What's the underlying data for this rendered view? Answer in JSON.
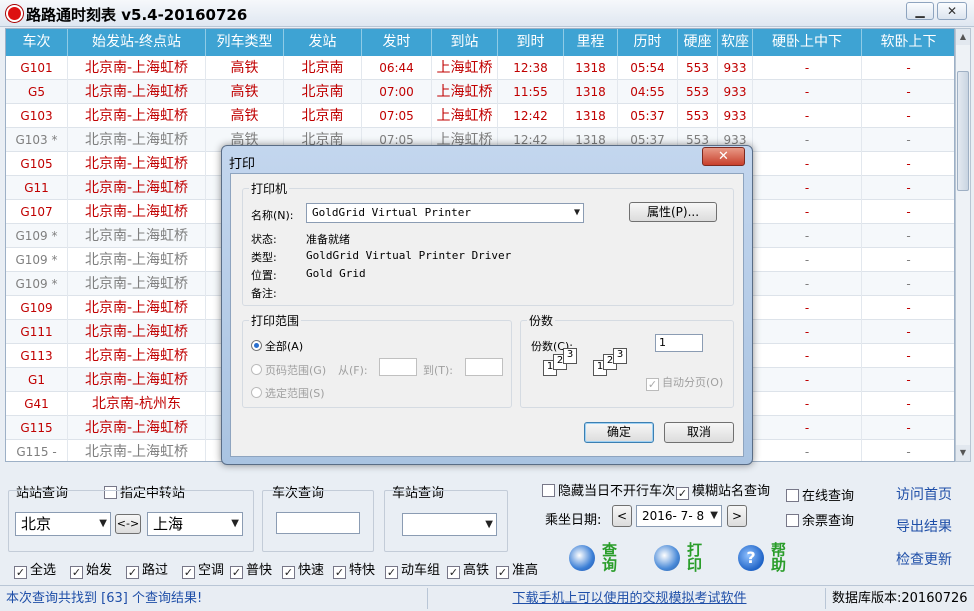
{
  "window": {
    "title": "路路通时刻表 v5.4-20160726",
    "min": "▁",
    "close": "✕"
  },
  "table": {
    "headers": [
      "车次",
      "始发站-终点站",
      "列车类型",
      "发站",
      "发时",
      "到站",
      "到时",
      "里程",
      "历时",
      "硬座",
      "软座",
      "硬卧上中下",
      "软卧上下"
    ],
    "rows": [
      {
        "style": "red",
        "cells": [
          "G101",
          "北京南-上海虹桥",
          "高铁",
          "北京南",
          "06:44",
          "上海虹桥",
          "12:38",
          "1318",
          "05:54",
          "553",
          "933",
          "-",
          "-"
        ]
      },
      {
        "style": "red",
        "cells": [
          "G5",
          "北京南-上海虹桥",
          "高铁",
          "北京南",
          "07:00",
          "上海虹桥",
          "11:55",
          "1318",
          "04:55",
          "553",
          "933",
          "-",
          "-"
        ]
      },
      {
        "style": "red",
        "cells": [
          "G103",
          "北京南-上海虹桥",
          "高铁",
          "北京南",
          "07:05",
          "上海虹桥",
          "12:42",
          "1318",
          "05:37",
          "553",
          "933",
          "-",
          "-"
        ]
      },
      {
        "style": "gray",
        "cells": [
          "G103 *",
          "北京南-上海虹桥",
          "高铁",
          "北京南",
          "07:05",
          "上海虹桥",
          "12:42",
          "1318",
          "05:37",
          "553",
          "933",
          "-",
          "-"
        ]
      },
      {
        "style": "red",
        "cells": [
          "G105",
          "北京南-上海虹桥",
          "",
          "",
          "",
          "",
          "",
          "",
          "",
          "",
          "",
          "-",
          "-"
        ]
      },
      {
        "style": "red",
        "cells": [
          "G11",
          "北京南-上海虹桥",
          "",
          "",
          "",
          "",
          "",
          "",
          "",
          "",
          "",
          "-",
          "-"
        ]
      },
      {
        "style": "red",
        "cells": [
          "G107",
          "北京南-上海虹桥",
          "",
          "",
          "",
          "",
          "",
          "",
          "",
          "",
          "",
          "-",
          "-"
        ]
      },
      {
        "style": "gray",
        "cells": [
          "G109 *",
          "北京南-上海虹桥",
          "",
          "",
          "",
          "",
          "",
          "",
          "",
          "",
          "",
          "-",
          "-"
        ]
      },
      {
        "style": "gray",
        "cells": [
          "G109 *",
          "北京南-上海虹桥",
          "",
          "",
          "",
          "",
          "",
          "",
          "",
          "",
          "",
          "-",
          "-"
        ]
      },
      {
        "style": "gray",
        "cells": [
          "G109 *",
          "北京南-上海虹桥",
          "",
          "",
          "",
          "",
          "",
          "",
          "",
          "",
          "",
          "-",
          "-"
        ]
      },
      {
        "style": "red",
        "cells": [
          "G109",
          "北京南-上海虹桥",
          "",
          "",
          "",
          "",
          "",
          "",
          "",
          "",
          "",
          "-",
          "-"
        ]
      },
      {
        "style": "red",
        "cells": [
          "G111",
          "北京南-上海虹桥",
          "",
          "",
          "",
          "",
          "",
          "",
          "",
          "",
          "",
          "-",
          "-"
        ]
      },
      {
        "style": "red",
        "cells": [
          "G113",
          "北京南-上海虹桥",
          "",
          "",
          "",
          "",
          "",
          "",
          "",
          "",
          "",
          "-",
          "-"
        ]
      },
      {
        "style": "red",
        "cells": [
          "G1",
          "北京南-上海虹桥",
          "",
          "",
          "",
          "",
          "",
          "",
          "",
          "",
          "",
          "-",
          "-"
        ]
      },
      {
        "style": "red",
        "cells": [
          "G41",
          "北京南-杭州东",
          "",
          "",
          "",
          "",
          "",
          "",
          "",
          "",
          "",
          "-",
          "-"
        ]
      },
      {
        "style": "red",
        "cells": [
          "G115",
          "北京南-上海虹桥",
          "",
          "",
          "",
          "",
          "",
          "",
          "",
          "",
          "",
          "-",
          "-"
        ]
      },
      {
        "style": "gray",
        "cells": [
          "G115 -",
          "北京南-上海虹桥",
          "",
          "",
          "",
          "",
          "",
          "",
          "",
          "",
          "",
          "-",
          "-"
        ]
      }
    ]
  },
  "query": {
    "station_title": "站站查询",
    "transfer_label": "指定中转站",
    "from": "北京",
    "swap": "<->",
    "to": "上海",
    "train_title": "车次查询",
    "train_value": "",
    "stn_title": "车站查询",
    "stn_value": "",
    "hide_label": "隐藏当日不开行车次",
    "fuzzy_label": "模糊站名查询",
    "date_label": "乘坐日期:",
    "date_value": "2016- 7- 8",
    "prev": "<",
    "next": ">",
    "online_label": "在线查询",
    "ticket_label": "余票查询",
    "btn_query": "查询",
    "btn_print": "打印",
    "btn_help": "帮助",
    "link_home": "访问首页",
    "link_export": "导出结果",
    "link_update": "检查更新"
  },
  "filters": [
    "全选",
    "始发",
    "路过",
    "空调",
    "普快",
    "快速",
    "特快",
    "动车组",
    "高铁",
    "准高"
  ],
  "status": {
    "result": "本次查询共找到 [63] 个查询结果!",
    "download": "下载手机上可以使用的交规模拟考试软件",
    "db": "数据库版本:20160726"
  },
  "dialog": {
    "title": "打印",
    "close": "✕",
    "printer_group": "打印机",
    "name_label": "名称(N):",
    "name_value": "GoldGrid Virtual Printer",
    "props_button": "属性(P)...",
    "status_label": "状态:",
    "status_value": "准备就绪",
    "type_label": "类型:",
    "type_value": "GoldGrid Virtual Printer Driver",
    "loc_label": "位置:",
    "loc_value": "Gold Grid",
    "note_label": "备注:",
    "range_group": "打印范围",
    "all_label": "全部(A)",
    "pages_label": "页码范围(G)",
    "from_label": "从(F):",
    "to_label": "到(T):",
    "sel_label": "选定范围(S)",
    "copies_group": "份数",
    "copies_label": "份数(C):",
    "copies_value": "1",
    "collate_label": "自动分页(O)",
    "ok": "确定",
    "cancel": "取消"
  }
}
